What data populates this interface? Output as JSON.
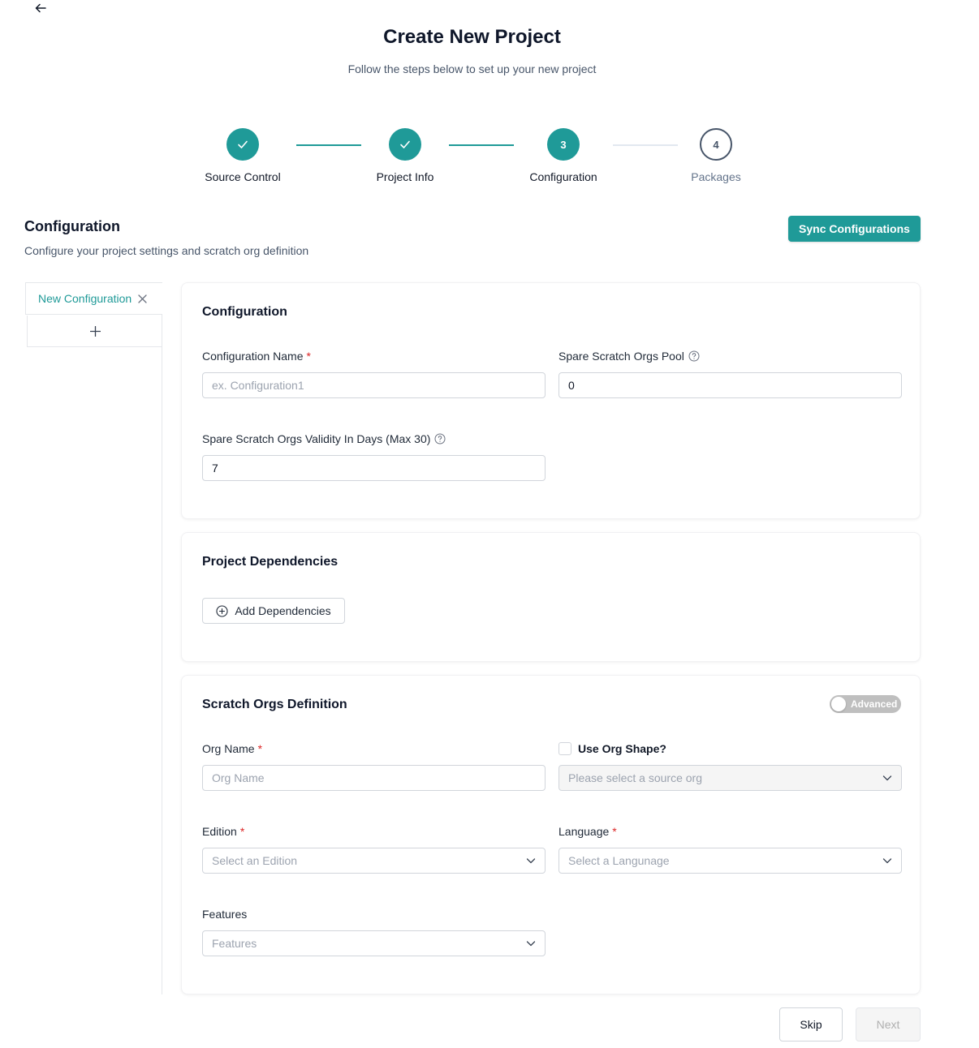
{
  "header": {
    "title": "Create New Project",
    "subtitle": "Follow the steps below to set up your new project"
  },
  "stepper": {
    "steps": [
      {
        "label": "Source Control",
        "number": "1",
        "status": "completed"
      },
      {
        "label": "Project Info",
        "number": "2",
        "status": "completed"
      },
      {
        "label": "Configuration",
        "number": "3",
        "status": "active"
      },
      {
        "label": "Packages",
        "number": "4",
        "status": "pending"
      }
    ]
  },
  "section": {
    "title": "Configuration",
    "description": "Configure your project settings and scratch org definition",
    "sync_label": "Sync Configurations"
  },
  "tabs": {
    "items": [
      {
        "label": "New Configuration"
      }
    ],
    "add_label": "+"
  },
  "config_card": {
    "title": "Configuration",
    "name_label": "Configuration Name",
    "name_placeholder": "ex. Configuration1",
    "name_value": "",
    "pool_label": "Spare Scratch Orgs Pool",
    "pool_value": "0",
    "validity_label": "Spare Scratch Orgs Validity In Days (Max 30)",
    "validity_value": "7"
  },
  "deps_card": {
    "title": "Project Dependencies",
    "add_label": "Add Dependencies"
  },
  "scratch_card": {
    "title": "Scratch Orgs Definition",
    "advanced_label": "Advanced",
    "advanced_on": false,
    "org_name_label": "Org Name",
    "org_name_placeholder": "Org Name",
    "org_shape_label": "Use Org Shape?",
    "org_shape_checked": false,
    "source_org_placeholder": "Please select a source org",
    "edition_label": "Edition",
    "edition_placeholder": "Select an Edition",
    "language_label": "Language",
    "language_placeholder": "Select a Langunage",
    "features_label": "Features",
    "features_placeholder": "Features"
  },
  "footer": {
    "skip_label": "Skip",
    "next_label": "Next"
  },
  "colors": {
    "accent": "#1f9a98",
    "required": "#dc2626"
  }
}
